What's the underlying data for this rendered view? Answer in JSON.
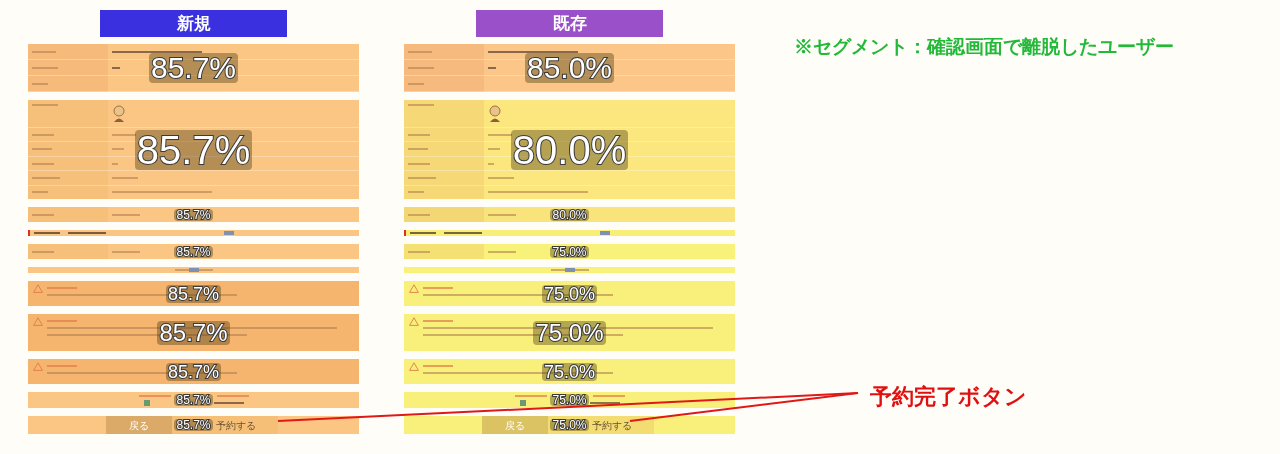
{
  "columns": [
    {
      "label": "新規",
      "color": "#3b30e0",
      "blocks": [
        {
          "kind": "info-table",
          "percent": "85.7%",
          "color": "#fbc683"
        },
        {
          "kind": "profile-table",
          "percent": "85.7%",
          "color": "#fbc683"
        },
        {
          "kind": "row",
          "percent": "85.7%",
          "color": "#fbc683"
        },
        {
          "kind": "marker-row",
          "color": "#fbc683"
        },
        {
          "kind": "row",
          "percent": "85.7%",
          "color": "#fbc683"
        },
        {
          "kind": "thin-row",
          "color": "#fbc683"
        },
        {
          "kind": "warning",
          "percent": "85.7%",
          "color": "#f6b56f"
        },
        {
          "kind": "warning-long",
          "percent": "85.7%",
          "color": "#f6b56f"
        },
        {
          "kind": "warning",
          "percent": "85.7%",
          "color": "#f6b56f"
        },
        {
          "kind": "checkbox-row",
          "percent": "85.7%",
          "color": "#fbc683",
          "checked": true
        },
        {
          "kind": "buttons",
          "percent": "85.7%",
          "color": "#fbc683",
          "buttons": [
            "戻る",
            "予約する"
          ]
        }
      ]
    },
    {
      "label": "既存",
      "color": "#9a50c8",
      "blocks": [
        {
          "kind": "info-table",
          "percent": "85.0%",
          "color": "#fbc687"
        },
        {
          "kind": "profile-table",
          "percent": "80.0%",
          "color": "#fbe77e"
        },
        {
          "kind": "row",
          "percent": "80.0%",
          "color": "#f9e47c"
        },
        {
          "kind": "marker-row",
          "color": "#f9ef78"
        },
        {
          "kind": "row",
          "percent": "75.0%",
          "color": "#f8f17a"
        },
        {
          "kind": "thin-row",
          "color": "#f8f17a"
        },
        {
          "kind": "warning",
          "percent": "75.0%",
          "color": "#f8f07a"
        },
        {
          "kind": "warning-long",
          "percent": "75.0%",
          "color": "#f8f07a"
        },
        {
          "kind": "warning",
          "percent": "75.0%",
          "color": "#f8f07a"
        },
        {
          "kind": "checkbox-row",
          "percent": "75.0%",
          "color": "#f8f07a",
          "checked": true
        },
        {
          "kind": "buttons",
          "percent": "75.0%",
          "color": "#f8f07a",
          "buttons": [
            "戻る",
            "予約する"
          ]
        }
      ]
    }
  ],
  "segment_note": "※セグメント：確認画面で離脱したユーザー",
  "callout": "予約完了ボタン"
}
